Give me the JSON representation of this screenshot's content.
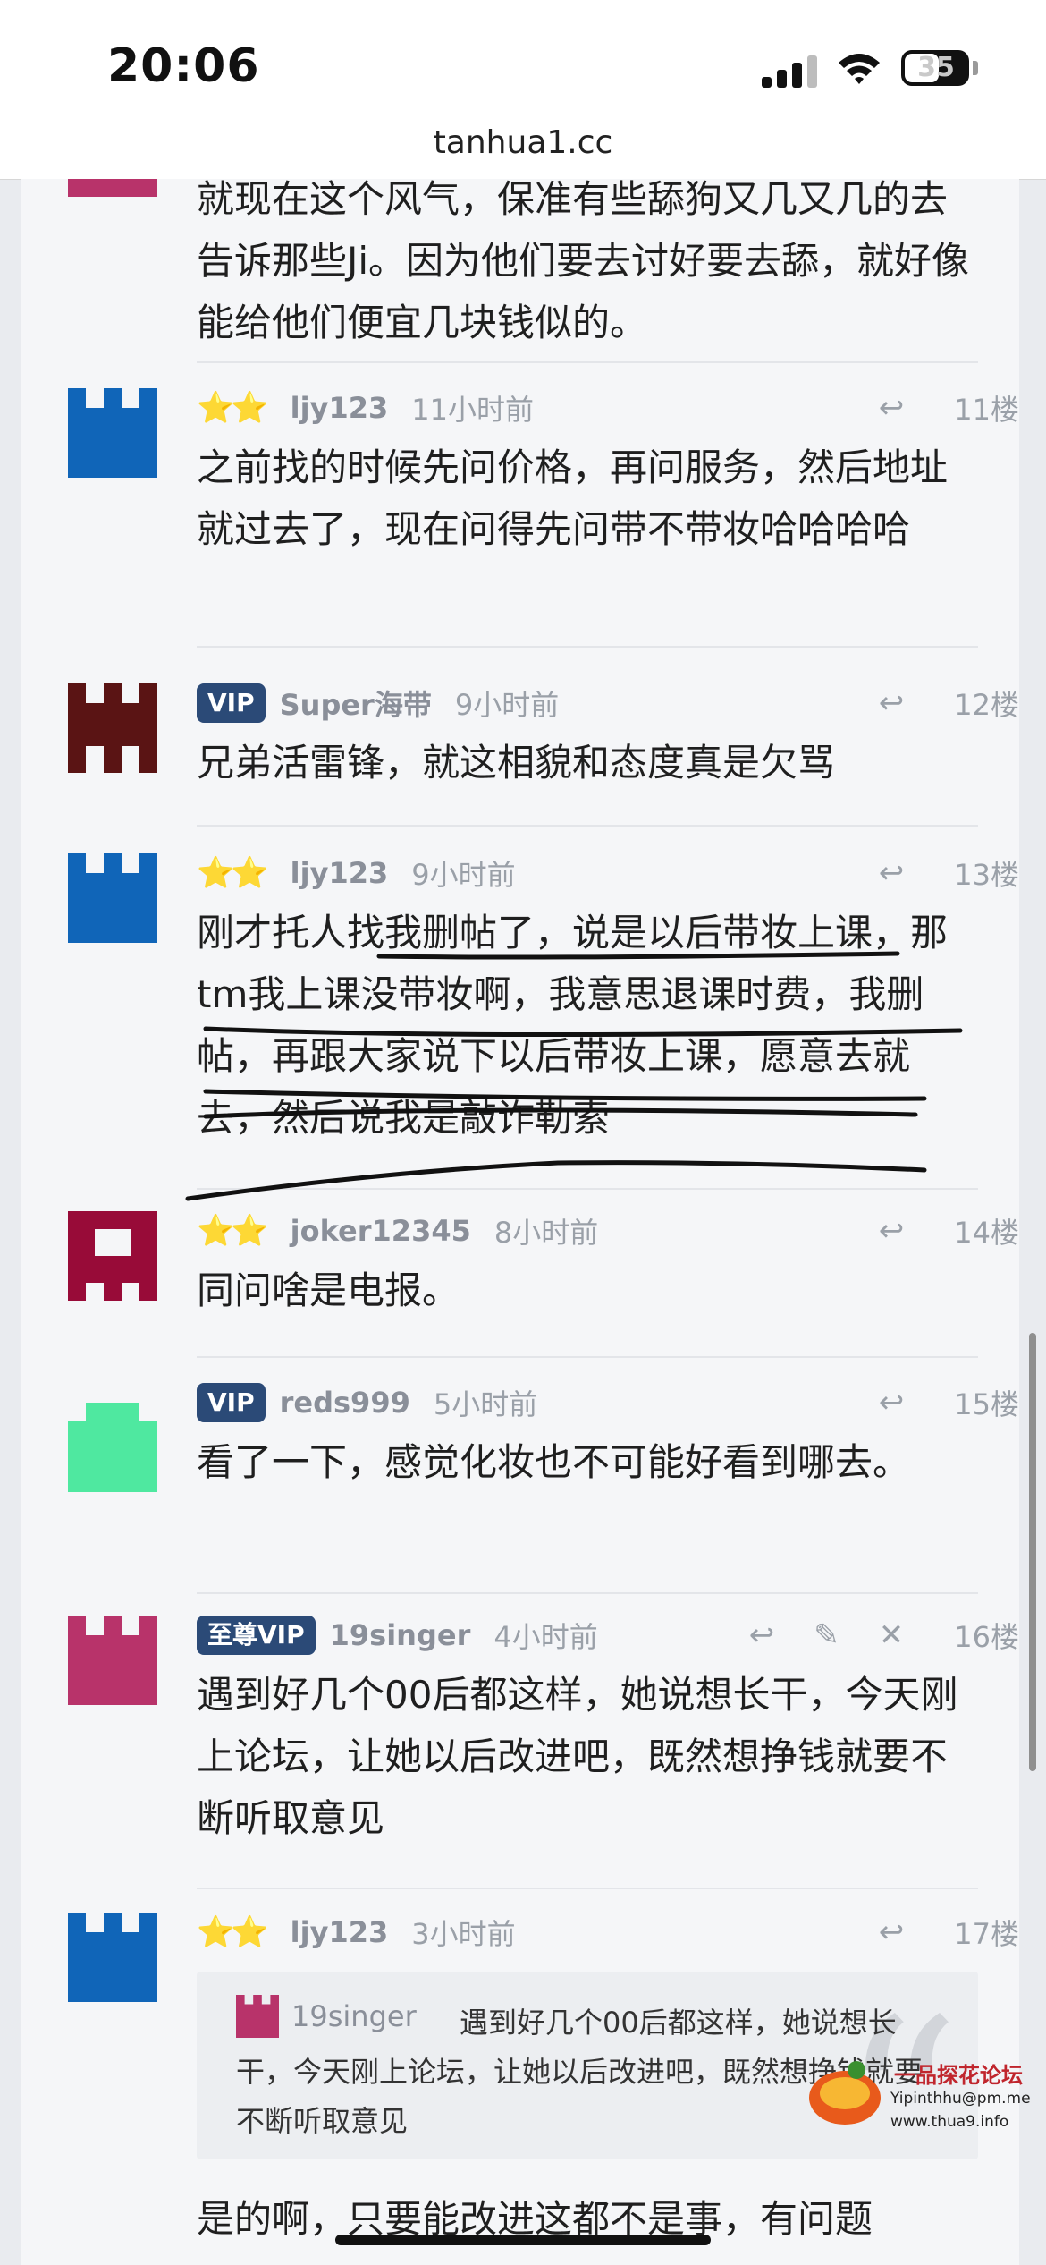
{
  "status_bar": {
    "time": "20:06",
    "battery": "35"
  },
  "browser": {
    "url": "tanhua1.cc"
  },
  "posts": [
    {
      "body": "就现在这个风气，保准有些舔狗又几又几的去告诉那些Ji。因为他们要去讨好要去舔，就好像能给他们便宜几块钱似的。"
    },
    {
      "badge": "",
      "author": "ljy123",
      "time": "11小时前",
      "floor": "11楼",
      "avatar_color": "#1065b8",
      "body": "之前找的时候先问价格，再问服务，然后地址就过去了，现在问得先问带不带妆哈哈哈哈"
    },
    {
      "badge": "VIP",
      "author": "Super海带",
      "time": "9小时前",
      "floor": "12楼",
      "avatar_color": "#5a1414",
      "body": "兄弟活雷锋，就这相貌和态度真是欠骂"
    },
    {
      "badge": "",
      "author": "ljy123",
      "time": "9小时前",
      "floor": "13楼",
      "avatar_color": "#1065b8",
      "body": "刚才托人找我删帖了，说是以后带妆上课，那tm我上课没带妆啊，我意思退课时费，我删帖，再跟大家说下以后带妆上课，愿意去就去，然后说我是敲诈勒索"
    },
    {
      "badge": "",
      "author": "joker12345",
      "time": "8小时前",
      "floor": "14楼",
      "avatar_color": "#980b38",
      "body": "同问啥是电报。"
    },
    {
      "badge": "VIP",
      "author": "reds999",
      "time": "5小时前",
      "floor": "15楼",
      "avatar_color": "#4fe8a0",
      "body": "看了一下，感觉化妆也不可能好看到哪去。"
    },
    {
      "badge": "至尊VIP",
      "author": "19singer",
      "time": "4小时前",
      "floor": "16楼",
      "avatar_color": "#b8336a",
      "body": "遇到好几个00后都这样，她说想长干，今天刚上论坛，让她以后改进吧，既然想挣钱就要不断听取意见"
    },
    {
      "badge": "",
      "author": "ljy123",
      "time": "3小时前",
      "floor": "17楼",
      "avatar_color": "#1065b8",
      "quote_user": "19singer",
      "quote_text": "遇到好几个00后都这样，她说想长干，今天刚上论坛，让她以后改进吧，既然想挣钱就要不断听取意见",
      "body": "是的啊，只要能改进这都不是事，有问题"
    }
  ],
  "watermark": {
    "title": "一品探花论坛",
    "line1": "Yipinthhu@pm.me",
    "line2": "www.thua9.info"
  },
  "icons": {
    "reply": "reply-icon",
    "edit": "edit-icon",
    "delete": "delete-icon"
  }
}
